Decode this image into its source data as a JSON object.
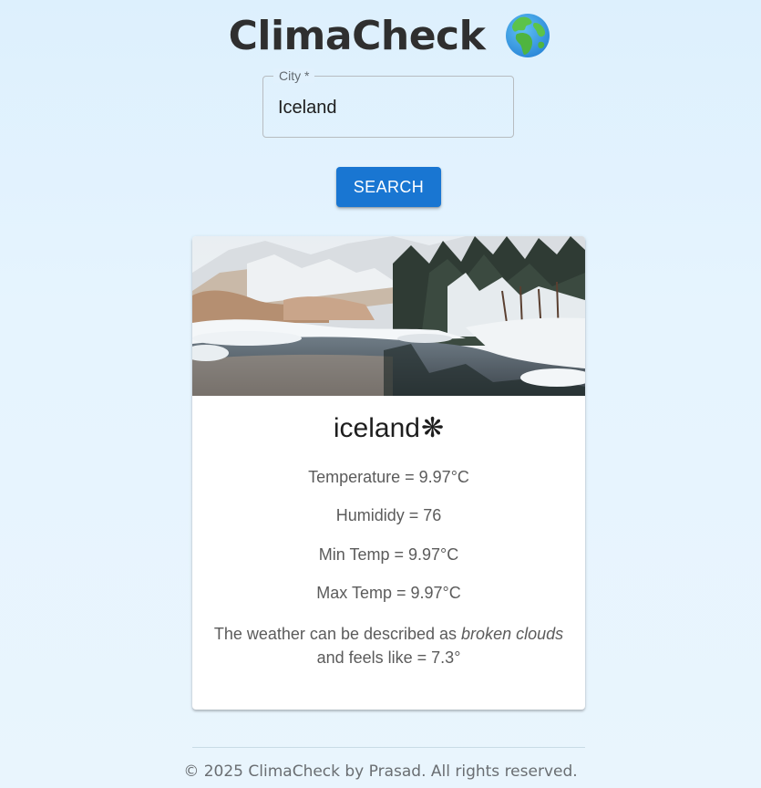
{
  "app": {
    "title": "ClimaCheck",
    "title_icon": "globe-europe-africa-icon"
  },
  "search": {
    "label": "City *",
    "value": "Iceland",
    "button_label": "SEARCH"
  },
  "card": {
    "image": "snowy-river-landscape",
    "city": "iceland",
    "weather_icon": "snowflake-icon",
    "weather_glyph": "❋",
    "temperature": "Temperature = 9.97°C",
    "humidity": "Humididy = 76",
    "min_temp": "Min Temp = 9.97°C",
    "max_temp": "Max Temp = 9.97°C",
    "description_prefix": "The weather can be described as ",
    "description_condition": "broken clouds",
    "description_suffix": "and feels like = 7.3°"
  },
  "footer": {
    "text": "© 2025 ClimaCheck by Prasad. All rights reserved."
  },
  "colors": {
    "primary": "#1976d2",
    "background": "#e4f3fe",
    "title": "#2f2f2f",
    "text_secondary": "#5b5b5b"
  }
}
